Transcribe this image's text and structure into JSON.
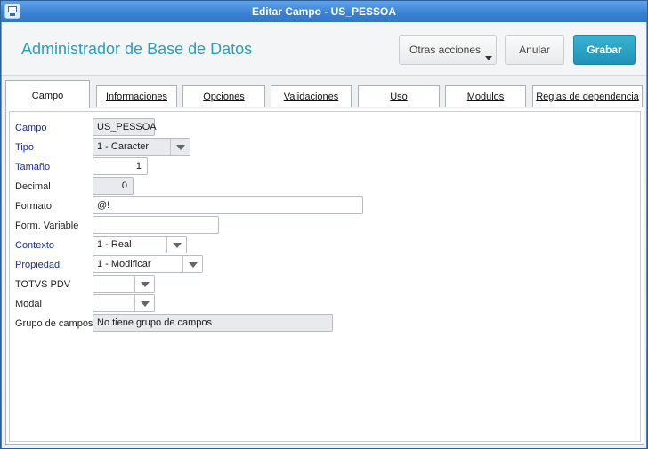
{
  "window": {
    "title": "Editar Campo - US_PESSOA"
  },
  "header": {
    "app_title": "Administrador de Base de Datos",
    "otras_label": "Otras acciones",
    "anular_label": "Anular",
    "grabar_label": "Grabar"
  },
  "tabs": [
    {
      "label": "Campo",
      "active": true
    },
    {
      "label": "Informaciones"
    },
    {
      "label": "Opciones"
    },
    {
      "label": "Validaciones"
    },
    {
      "label": "Uso"
    },
    {
      "label": "Modulos"
    },
    {
      "label": "Reglas de dependencia"
    }
  ],
  "form": {
    "campo": {
      "label": "Campo",
      "value": "US_PESSOA"
    },
    "tipo": {
      "label": "Tipo",
      "value": "1 - Caracter"
    },
    "tamano": {
      "label": "Tamaño",
      "value": "1"
    },
    "decimal": {
      "label": "Decimal",
      "value": "0"
    },
    "formato": {
      "label": "Formato",
      "value": "@!"
    },
    "form_var": {
      "label": "Form. Variable",
      "value": ""
    },
    "contexto": {
      "label": "Contexto",
      "value": "1 - Real"
    },
    "propiedad": {
      "label": "Propiedad",
      "value": "1 - Modificar"
    },
    "totvs_pdv": {
      "label": "TOTVS PDV",
      "value": ""
    },
    "modal": {
      "label": "Modal",
      "value": ""
    },
    "grupo": {
      "label": "Grupo de campos",
      "value": "No tiene grupo de campos"
    }
  },
  "colors": {
    "accent": "#2a9fb8",
    "primary_button": "#1e93b7",
    "required_label": "#1a2ea0",
    "titlebar": "#3a80d2"
  }
}
